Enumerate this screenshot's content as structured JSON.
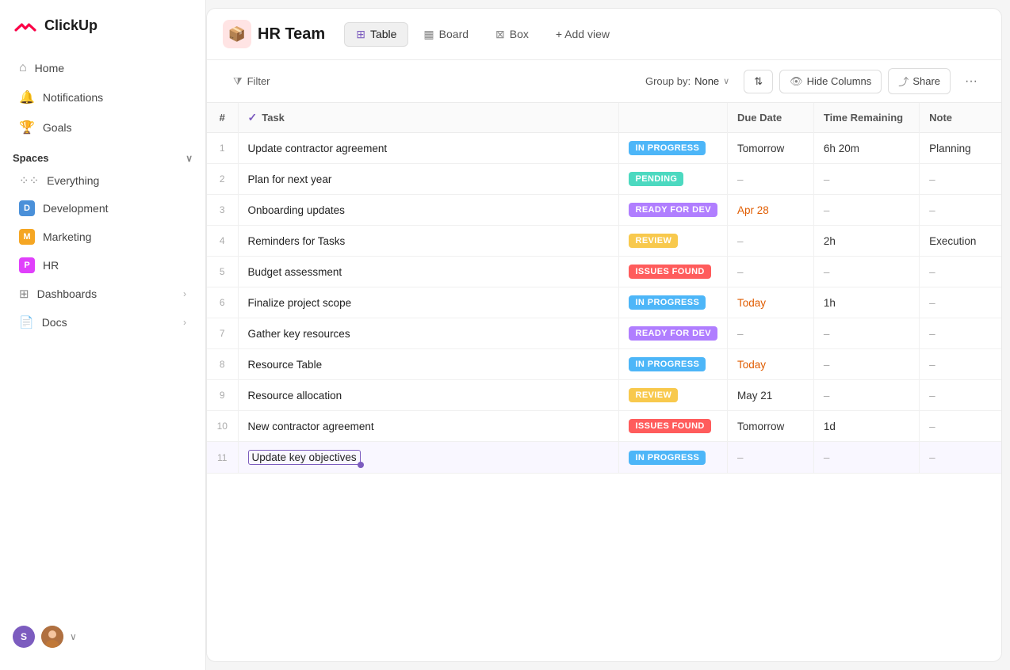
{
  "app": {
    "name": "ClickUp"
  },
  "sidebar": {
    "nav": [
      {
        "id": "home",
        "label": "Home",
        "icon": "⌂"
      },
      {
        "id": "notifications",
        "label": "Notifications",
        "icon": "🔔"
      },
      {
        "id": "goals",
        "label": "Goals",
        "icon": "🏆"
      }
    ],
    "spaces_label": "Spaces",
    "everything_label": "Everything",
    "spaces": [
      {
        "id": "development",
        "label": "Development",
        "initial": "D",
        "color": "#4a90d9"
      },
      {
        "id": "marketing",
        "label": "Marketing",
        "initial": "M",
        "color": "#f5a623"
      },
      {
        "id": "hr",
        "label": "HR",
        "initial": "P",
        "color": "#e040fb"
      }
    ],
    "other": [
      {
        "id": "dashboards",
        "label": "Dashboards"
      },
      {
        "id": "docs",
        "label": "Docs"
      }
    ]
  },
  "project": {
    "title": "HR Team",
    "icon": "📦"
  },
  "views": [
    {
      "id": "table",
      "label": "Table",
      "icon": "⊞",
      "active": true
    },
    {
      "id": "board",
      "label": "Board",
      "icon": "▦"
    },
    {
      "id": "box",
      "label": "Box",
      "icon": "⊠"
    }
  ],
  "add_view_label": "+ Add view",
  "toolbar": {
    "filter_label": "Filter",
    "groupby_label": "Group by:",
    "groupby_value": "None",
    "sort_label": "Sort",
    "hide_columns_label": "Hide Columns",
    "share_label": "Share"
  },
  "table": {
    "columns": [
      {
        "id": "num",
        "label": "#"
      },
      {
        "id": "task",
        "label": "Task"
      },
      {
        "id": "status",
        "label": ""
      },
      {
        "id": "due_date",
        "label": "Due Date"
      },
      {
        "id": "time_remaining",
        "label": "Time Remaining"
      },
      {
        "id": "note",
        "label": "Note"
      }
    ],
    "rows": [
      {
        "num": 1,
        "task": "Update contractor agreement",
        "status": "IN PROGRESS",
        "status_class": "badge-in-progress",
        "due_date": "Tomorrow",
        "due_class": "due-normal",
        "time_remaining": "6h 20m",
        "note": "Planning"
      },
      {
        "num": 2,
        "task": "Plan for next year",
        "status": "PENDING",
        "status_class": "badge-pending",
        "due_date": "–",
        "due_class": "dash",
        "time_remaining": "–",
        "note": "–"
      },
      {
        "num": 3,
        "task": "Onboarding updates",
        "status": "READY FOR DEV",
        "status_class": "badge-ready-for-dev",
        "due_date": "Apr 28",
        "due_class": "due-date",
        "time_remaining": "–",
        "note": "–"
      },
      {
        "num": 4,
        "task": "Reminders for Tasks",
        "status": "REVIEW",
        "status_class": "badge-review",
        "due_date": "–",
        "due_class": "dash",
        "time_remaining": "2h",
        "note": "Execution"
      },
      {
        "num": 5,
        "task": "Budget assessment",
        "status": "ISSUES FOUND",
        "status_class": "badge-issues-found",
        "due_date": "–",
        "due_class": "dash",
        "time_remaining": "–",
        "note": "–"
      },
      {
        "num": 6,
        "task": "Finalize project scope",
        "status": "IN PROGRESS",
        "status_class": "badge-in-progress",
        "due_date": "Today",
        "due_class": "due-today",
        "time_remaining": "1h",
        "note": "–"
      },
      {
        "num": 7,
        "task": "Gather key resources",
        "status": "READY FOR DEV",
        "status_class": "badge-ready-for-dev",
        "due_date": "–",
        "due_class": "dash",
        "time_remaining": "–",
        "note": "–"
      },
      {
        "num": 8,
        "task": "Resource Table",
        "status": "IN PROGRESS",
        "status_class": "badge-in-progress",
        "due_date": "Today",
        "due_class": "due-today",
        "time_remaining": "–",
        "note": "–"
      },
      {
        "num": 9,
        "task": "Resource allocation",
        "status": "REVIEW",
        "status_class": "badge-review",
        "due_date": "May 21",
        "due_class": "due-normal",
        "time_remaining": "–",
        "note": "–"
      },
      {
        "num": 10,
        "task": "New contractor agreement",
        "status": "ISSUES FOUND",
        "status_class": "badge-issues-found",
        "due_date": "Tomorrow",
        "due_class": "due-normal",
        "time_remaining": "1d",
        "note": "–"
      },
      {
        "num": 11,
        "task": "Update key objectives",
        "status": "IN PROGRESS",
        "status_class": "badge-in-progress",
        "due_date": "–",
        "due_class": "dash",
        "time_remaining": "–",
        "note": "–"
      }
    ]
  }
}
